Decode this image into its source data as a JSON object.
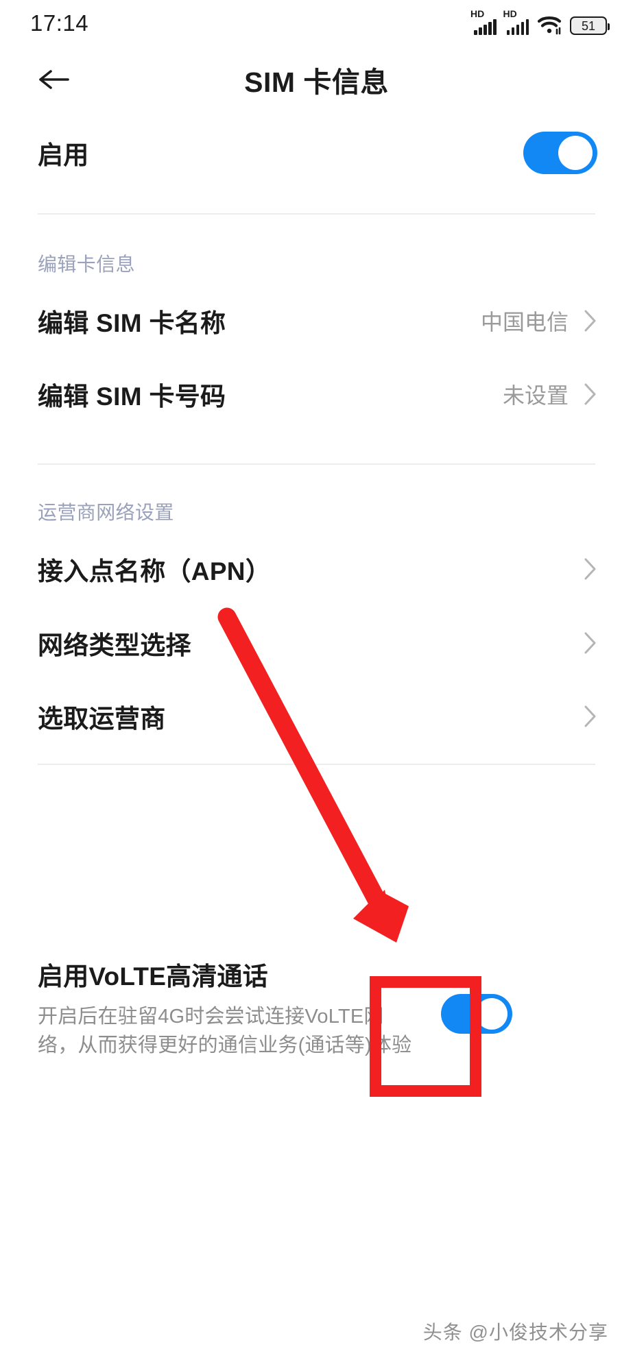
{
  "status_bar": {
    "time": "17:14",
    "signal_1_label": "HD",
    "signal_2_label": "HD",
    "wifi_icon": "wifi-icon",
    "battery_level": "51"
  },
  "app_bar": {
    "back_icon": "back-arrow-icon",
    "title": "SIM 卡信息"
  },
  "enable_row": {
    "label": "启用",
    "toggle_state": "on"
  },
  "sections": [
    {
      "header": "编辑卡信息",
      "items": [
        {
          "label": "编辑 SIM 卡名称",
          "value": "中国电信"
        },
        {
          "label": "编辑 SIM 卡号码",
          "value": "未设置"
        }
      ]
    },
    {
      "header": "运营商网络设置",
      "items": [
        {
          "label": "接入点名称（APN）",
          "value": ""
        },
        {
          "label": "网络类型选择",
          "value": ""
        },
        {
          "label": "选取运营商",
          "value": ""
        }
      ]
    }
  ],
  "volte": {
    "title": "启用VoLTE高清通话",
    "description": "开启后在驻留4G时会尝试连接VoLTE网络，从而获得更好的通信业务(通话等)体验",
    "toggle_state": "on"
  },
  "annotation": {
    "arrow_color": "#f22020",
    "box_color": "#f22020"
  },
  "watermark": "头条 @小俊技术分享",
  "colors": {
    "accent_blue": "#1288f5",
    "section_header": "#9aa1bb",
    "value_gray": "#9a9a9a",
    "desc_gray": "#8d8d8d",
    "divider": "#ececec"
  }
}
